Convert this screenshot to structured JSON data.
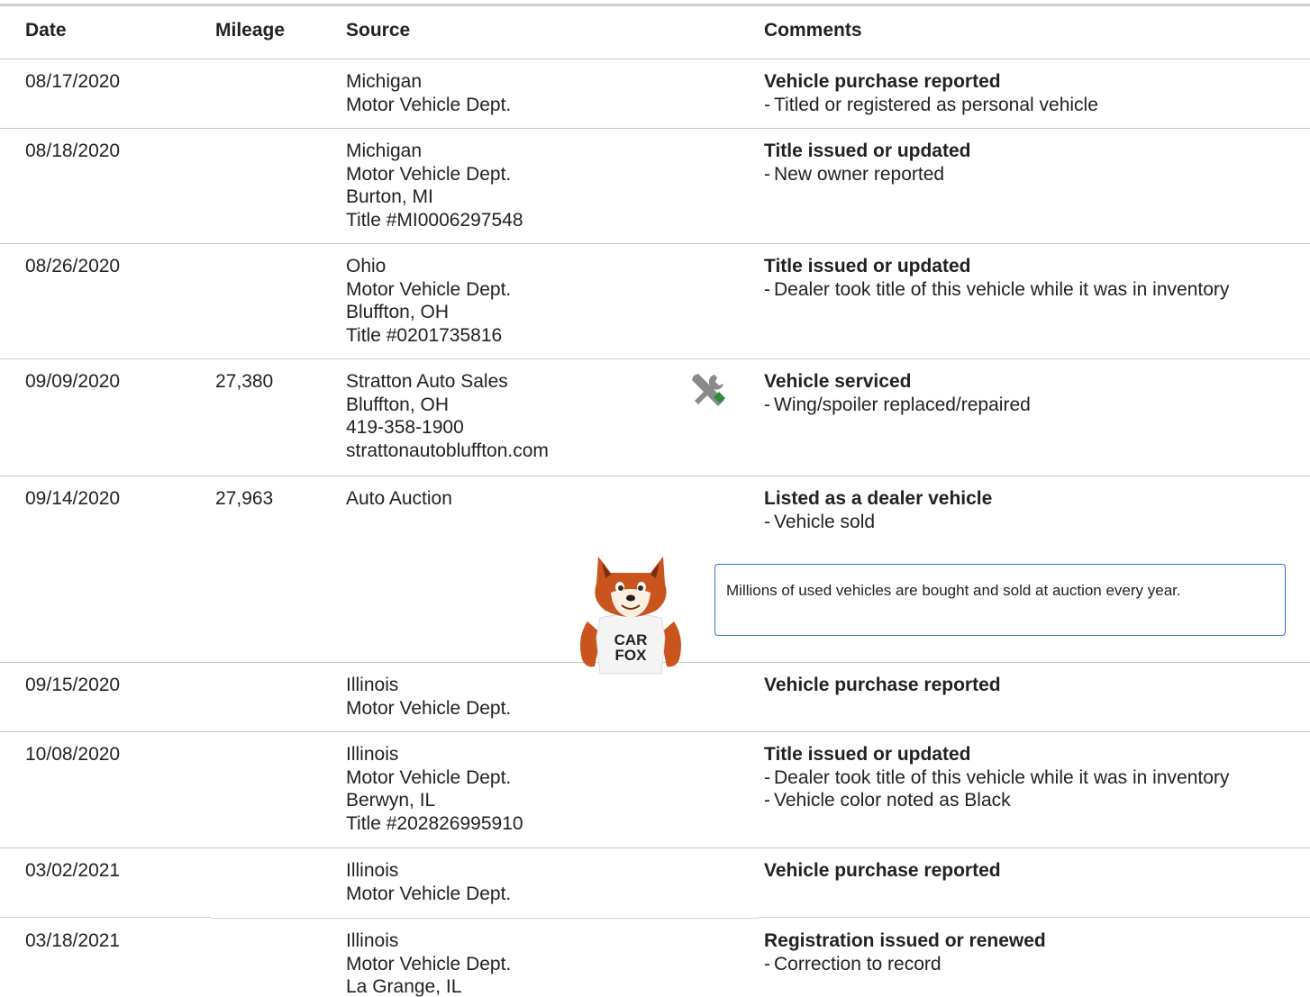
{
  "headers": {
    "date": "Date",
    "mileage": "Mileage",
    "source": "Source",
    "comments": "Comments"
  },
  "rows": [
    {
      "date": "08/17/2020",
      "mileage": "",
      "source": [
        "Michigan",
        "Motor Vehicle Dept."
      ],
      "comment_title": "Vehicle purchase reported",
      "comment_items": [
        "Titled or registered as personal vehicle"
      ]
    },
    {
      "date": "08/18/2020",
      "mileage": "",
      "source": [
        "Michigan",
        "Motor Vehicle Dept.",
        "Burton, MI",
        "Title #MI0006297548"
      ],
      "comment_title": "Title issued or updated",
      "comment_items": [
        "New owner reported"
      ]
    },
    {
      "date": "08/26/2020",
      "mileage": "",
      "source": [
        "Ohio",
        "Motor Vehicle Dept.",
        "Bluffton, OH",
        "Title #0201735816"
      ],
      "comment_title": "Title issued or updated",
      "comment_items": [
        "Dealer took title of this vehicle while it was in inventory"
      ]
    },
    {
      "date": "09/09/2020",
      "mileage": "27,380",
      "source": [
        "Stratton Auto Sales",
        "Bluffton, OH",
        "419-358-1900",
        "strattonautobluffton.com"
      ],
      "icon": "service-tools-icon",
      "comment_title": "Vehicle serviced",
      "comment_items": [
        "Wing/spoiler replaced/repaired"
      ]
    },
    {
      "date": "09/14/2020",
      "mileage": "27,963",
      "source": [
        "Auto Auction"
      ],
      "comment_title": "Listed as a dealer vehicle",
      "comment_items": [
        "Vehicle sold"
      ],
      "tip": "Millions of used vehicles are bought and sold at auction every year.",
      "mascot_shirt": [
        "CAR",
        "FOX"
      ]
    },
    {
      "date": "09/15/2020",
      "mileage": "",
      "source": [
        "Illinois",
        "Motor Vehicle Dept."
      ],
      "comment_title": "Vehicle purchase reported",
      "comment_items": []
    },
    {
      "date": "10/08/2020",
      "mileage": "",
      "source": [
        "Illinois",
        "Motor Vehicle Dept.",
        "Berwyn, IL",
        "Title #202826995910"
      ],
      "comment_title": "Title issued or updated",
      "comment_items": [
        "Dealer took title of this vehicle while it was in inventory",
        "Vehicle color noted as Black"
      ]
    },
    {
      "date": "03/02/2021",
      "mileage": "",
      "source": [
        "Illinois",
        "Motor Vehicle Dept."
      ],
      "comment_title": "Vehicle purchase reported",
      "comment_items": []
    },
    {
      "date": "03/18/2021",
      "mileage": "",
      "source": [
        "Illinois",
        "Motor Vehicle Dept.",
        "La Grange, IL"
      ],
      "comment_title": "Registration issued or renewed",
      "comment_items": [
        "Correction to record"
      ]
    }
  ],
  "dash": "-",
  "colors": {
    "border": "#c8c8c8",
    "tip_border": "#2d73c8",
    "icon_gray": "#8a8a8a",
    "icon_green": "#2e8b3a",
    "fox_orange": "#c9541e"
  }
}
